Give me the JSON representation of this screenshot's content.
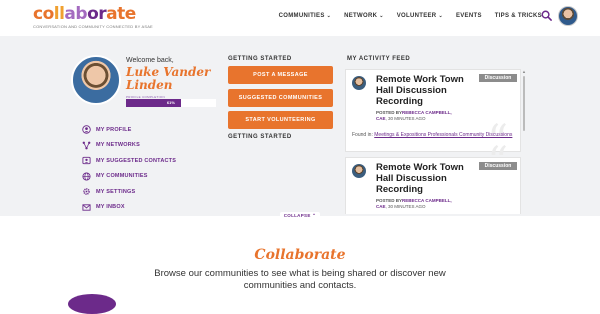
{
  "header": {
    "logo_text": "collaborate",
    "logo_tagline": "CONVERSATION AND COMMUNITY CONNECTED BY ASAE",
    "nav": [
      {
        "label": "COMMUNITIES",
        "dropdown": true
      },
      {
        "label": "NETWORK",
        "dropdown": true
      },
      {
        "label": "VOLUNTEER",
        "dropdown": true
      },
      {
        "label": "EVENTS",
        "dropdown": false
      },
      {
        "label": "TIPS & TRICKS",
        "dropdown": false
      }
    ],
    "search_icon": "search-icon"
  },
  "profile": {
    "welcome": "Welcome back,",
    "name": "Luke Vander Linden",
    "completion_label": "PROFILE COMPLETION",
    "completion_percent": 61,
    "completion_text": "61%"
  },
  "menu": [
    {
      "label": "MY PROFILE",
      "icon": "user-icon"
    },
    {
      "label": "MY NETWORKS",
      "icon": "network-icon"
    },
    {
      "label": "MY SUGGESTED CONTACTS",
      "icon": "contacts-icon"
    },
    {
      "label": "MY COMMUNITIES",
      "icon": "globe-icon"
    },
    {
      "label": "MY SETTINGS",
      "icon": "gear-icon"
    },
    {
      "label": "MY INBOX",
      "icon": "inbox-icon"
    }
  ],
  "getting_started": {
    "title_top": "GETTING STARTED",
    "title_bottom": "GETTING STARTED",
    "buttons": [
      "POST A MESSAGE",
      "SUGGESTED COMMUNITIES",
      "START VOLUNTEERING"
    ]
  },
  "feed": {
    "title": "MY ACTIVITY FEED",
    "items": [
      {
        "title": "Remote Work Town Hall Discussion Recording",
        "badge": "Discussion",
        "posted_by": "POSTED BY",
        "author": "REBECCA CAMPBELL,",
        "author_suffix": "CAE",
        "time": ", 30 MINUTES AGO",
        "found_in": "Found in:",
        "found_link": "Meetings & Expositions Professionals Community Discussions"
      },
      {
        "title": "Remote Work Town Hall Discussion Recording",
        "badge": "Discussion",
        "posted_by": "POSTED BY",
        "author": "REBECCA CAMPBELL,",
        "author_suffix": "CAE",
        "time": ", 30 MINUTES AGO"
      }
    ]
  },
  "collapse_label": "COLLAPSE ⌃",
  "below": {
    "title": "Collaborate",
    "text": "Browse our communities to see what is being shared or discover new communities and contacts."
  },
  "colors": {
    "orange": "#e8742d",
    "purple": "#6c2a8a",
    "panel": "#f1f2f4"
  }
}
